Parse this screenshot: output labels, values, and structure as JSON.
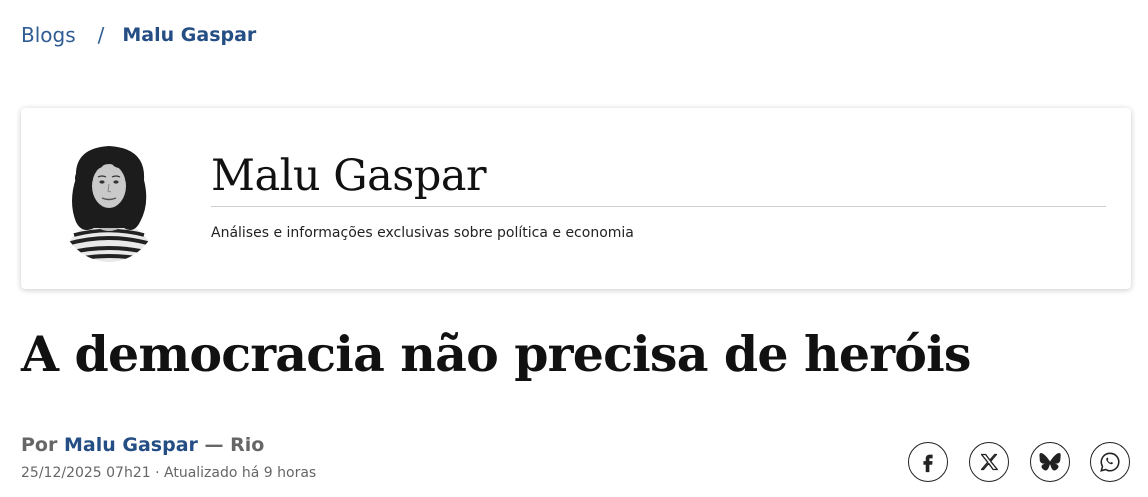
{
  "breadcrumb": {
    "root": "Blogs",
    "separator": "/",
    "current": "Malu Gaspar"
  },
  "blog_header": {
    "name": "Malu Gaspar",
    "description": "Análises e informações exclusivas sobre política e economia"
  },
  "article": {
    "headline": "A democracia não precisa de heróis",
    "byline_prefix": "Por",
    "author": "Malu Gaspar",
    "location": "— Rio",
    "timestamp": "25/12/2025 07h21 · Atualizado há 9 horas"
  },
  "share_buttons": [
    {
      "icon": "facebook-icon"
    },
    {
      "icon": "x-icon"
    },
    {
      "icon": "bluesky-icon"
    },
    {
      "icon": "whatsapp-icon"
    }
  ],
  "colors": {
    "brand_blue": "#244e84",
    "text_dark": "#111111",
    "text_muted": "#666666"
  }
}
